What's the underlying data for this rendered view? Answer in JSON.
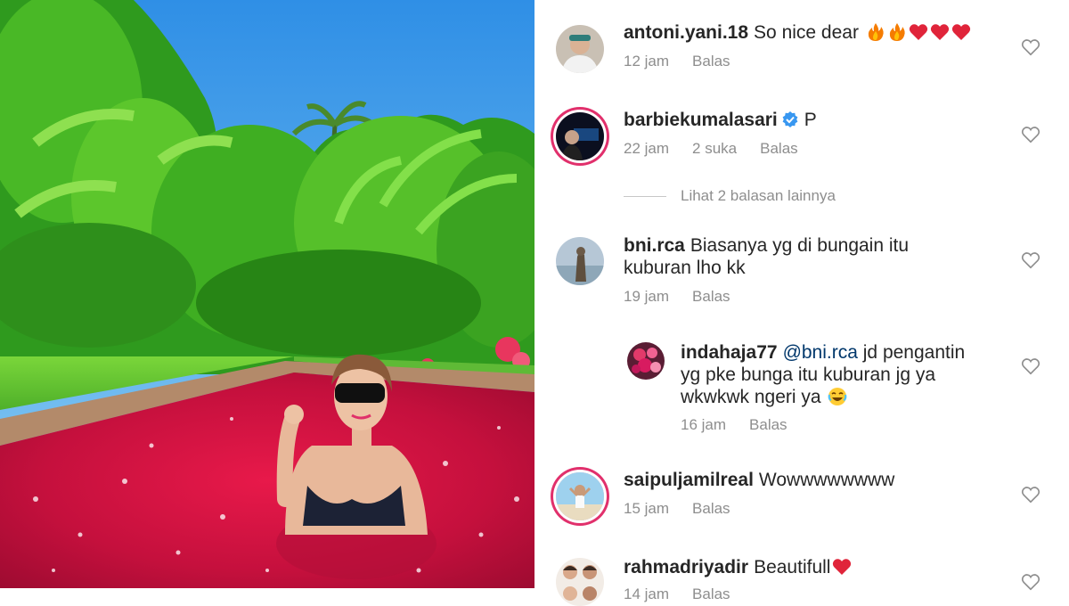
{
  "comments": [
    {
      "username": "antoni.yani.18",
      "text": "So nice dear",
      "time": "12 jam",
      "likes": "",
      "reply": "Balas",
      "emoji": [
        "fire-icon",
        "fire-icon",
        "red-heart-icon",
        "red-heart-icon",
        "red-heart-icon"
      ]
    },
    {
      "username": "barbiekumalasari",
      "verified": true,
      "text": "P",
      "time": "22 jam",
      "likes": "2 suka",
      "reply": "Balas"
    },
    {
      "username": "bni.rca",
      "text_line1": "Biasanya yg di bungain itu",
      "text_line2": "kuburan lho kk",
      "time": "19 jam",
      "reply": "Balas"
    },
    {
      "username": "indahaja77",
      "mention": "@bni.rca",
      "text_line1": "jd pengantin",
      "text_line2": "yg pke bunga itu kuburan jg ya",
      "text_line3": "wkwkwk ngeri ya",
      "time": "16 jam",
      "reply": "Balas",
      "emoji": [
        "laughing-tears-icon"
      ]
    },
    {
      "username": "saipuljamilreal",
      "text": "Wowwwwwwww",
      "time": "15 jam",
      "reply": "Balas"
    },
    {
      "username": "rahmadriyadir",
      "text": "Beautifull",
      "time": "14 jam",
      "reply": "Balas",
      "emoji": [
        "red-heart-icon"
      ]
    }
  ],
  "view_more_replies": "Lihat 2 balasan lainnya",
  "colors": {
    "text": "#262626",
    "meta": "#8e8e8e",
    "mention": "#00376b",
    "story_ring": "#e1306c",
    "verified": "#3897f0",
    "heart_red": "#ed4956"
  }
}
